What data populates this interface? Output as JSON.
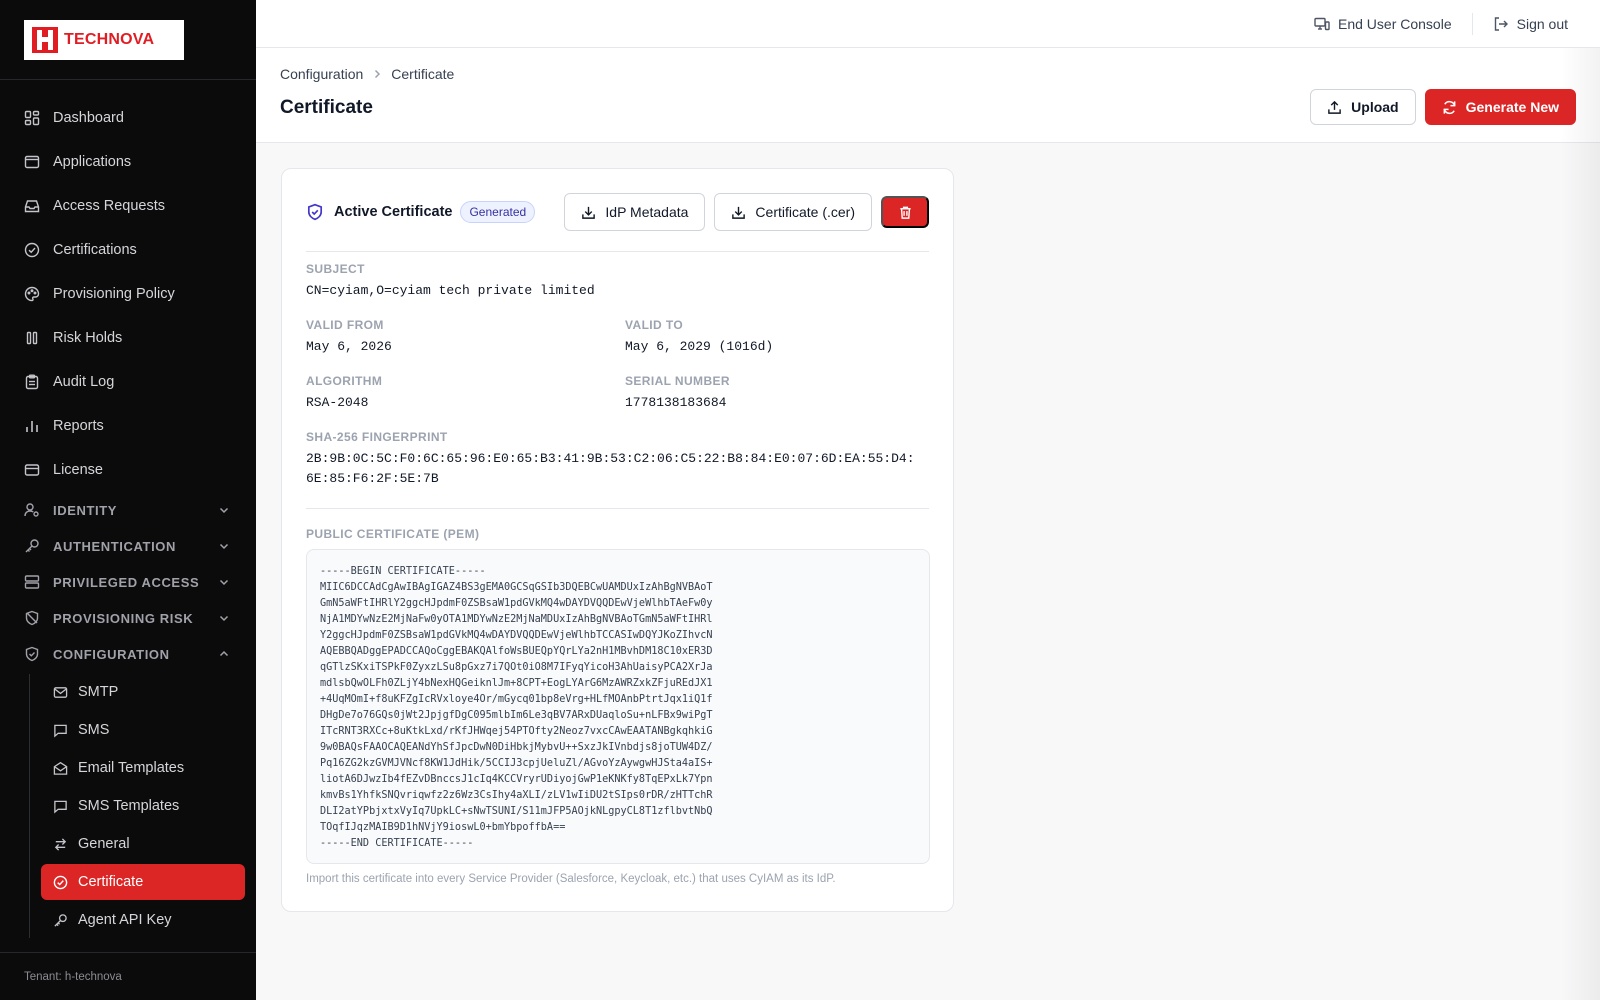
{
  "brand": {
    "name": "TECHNOVA",
    "accent": "#e11d24"
  },
  "sidebar": {
    "items": [
      {
        "label": "Dashboard",
        "icon": "dashboard-icon"
      },
      {
        "label": "Applications",
        "icon": "window-icon"
      },
      {
        "label": "Access Requests",
        "icon": "inbox-icon"
      },
      {
        "label": "Certifications",
        "icon": "check-circle-icon"
      },
      {
        "label": "Provisioning Policy",
        "icon": "palette-icon"
      },
      {
        "label": "Risk Holds",
        "icon": "pause-icon"
      },
      {
        "label": "Audit Log",
        "icon": "clipboard-icon"
      },
      {
        "label": "Reports",
        "icon": "bar-chart-icon"
      },
      {
        "label": "License",
        "icon": "card-icon"
      }
    ],
    "groups": [
      {
        "label": "IDENTITY",
        "expanded": false
      },
      {
        "label": "AUTHENTICATION",
        "expanded": false
      },
      {
        "label": "PRIVILEGED ACCESS",
        "expanded": false
      },
      {
        "label": "PROVISIONING RISK",
        "expanded": false
      },
      {
        "label": "CONFIGURATION",
        "expanded": true
      }
    ],
    "config_items": [
      {
        "label": "SMTP",
        "icon": "mail-icon"
      },
      {
        "label": "SMS",
        "icon": "message-icon"
      },
      {
        "label": "Email Templates",
        "icon": "mail-open-icon"
      },
      {
        "label": "SMS Templates",
        "icon": "message-icon"
      },
      {
        "label": "General",
        "icon": "swap-icon"
      },
      {
        "label": "Certificate",
        "icon": "certificate-icon",
        "active": true
      },
      {
        "label": "Agent API Key",
        "icon": "key-icon"
      }
    ],
    "tenant": "Tenant: h-technova"
  },
  "topbar": {
    "end_user_console": "End User Console",
    "sign_out": "Sign out"
  },
  "header": {
    "breadcrumb": [
      "Configuration",
      "Certificate"
    ],
    "title": "Certificate",
    "upload_label": "Upload",
    "generate_label": "Generate New"
  },
  "certificate": {
    "title": "Active Certificate",
    "badge": "Generated",
    "idp_metadata_label": "IdP Metadata",
    "cert_download_label": "Certificate (.cer)",
    "subject_label": "SUBJECT",
    "subject": "CN=cyiam,O=cyiam tech private limited",
    "valid_from_label": "VALID FROM",
    "valid_from": "May 6, 2026",
    "valid_to_label": "VALID TO",
    "valid_to": "May 6, 2029 (1016d)",
    "algorithm_label": "ALGORITHM",
    "algorithm": "RSA-2048",
    "serial_label": "SERIAL NUMBER",
    "serial": "1778138183684",
    "fingerprint_label": "SHA-256 FINGERPRINT",
    "fingerprint": "2B:9B:0C:5C:F0:6C:65:96:E0:65:B3:41:9B:53:C2:06:C5:22:B8:84:E0:07:6D:EA:55:D4:6E:85:F6:2F:5E:7B",
    "pem_label": "PUBLIC CERTIFICATE (PEM)",
    "pem": "-----BEGIN CERTIFICATE-----\nMIIC6DCCAdCgAwIBAgIGAZ4BS3gEMA0GCSqGSIb3DQEBCwUAMDUxIzAhBgNVBAoT\nGmN5aWFtIHRlY2ggcHJpdmF0ZSBsaW1pdGVkMQ4wDAYDVQQDEwVjeWlhbTAeFw0y\nNjA1MDYwNzE2MjNaFw0yOTA1MDYwNzE2MjNaMDUxIzAhBgNVBAoTGmN5aWFtIHRl\nY2ggcHJpdmF0ZSBsaW1pdGVkMQ4wDAYDVQQDEwVjeWlhbTCCASIwDQYJKoZIhvcN\nAQEBBQADggEPADCCAQoCggEBAKQAlfoWsBUEQpYQrLYa2nH1MBvhDM18C10xER3D\nqGTlzSKxiTSPkF0ZyxzLSu8pGxz7i7QOt0iO8M7IFyqYicoH3AhUaisyPCA2XrJa\nmdlsbQwOLFh0ZLjY4bNexHQGeiknlJm+8CPT+EogLYArG6MzAWRZxkZFjuREdJX1\n+4UqMOmI+f8uKFZgIcRVxloye4Or/mGycq01bp8eVrg+HLfMOAnbPtrtJqx1iQ1f\nDHgDe7o76GQs0jWt2JpjgfDgC095mlbIm6Le3qBV7ARxDUaqloSu+nLFBx9wiPgT\nITcRNT3RXCc+8uKtkLxd/rKfJHWqej54PTOfty2Neoz7vxcCAwEAATANBgkqhkiG\n9w0BAQsFAAOCAQEANdYhSfJpcDwN0DiHbkjMybvU++SxzJkIVnbdjs8joTUW4DZ/\nPq16ZG2kzGVMJVNcf8KW1JdHik/5CCIJ3cpjUeluZl/AGvoYzAywgwHJSta4aIS+\nliotA6DJwzIb4fEZvDBnccsJ1cIq4KCCVryrUDiyojGwP1eKNKfy8TqEPxLk7Ypn\nkmvBs1YhfkSNQvriqwfz2z6Wz3CsIhy4aXLI/zLV1wIiDU2tSIps0rDR/zHTTchR\nDLI2atYPbjxtxVyIq7UpkLC+sNwTSUNI/S11mJFP5AOjkNLgpyCL8T1zflbvtNbQ\nTOqfIJqzMAIB9D1hNVjY9ioswL0+bmYbpoffbA==\n-----END CERTIFICATE-----",
    "hint": "Import this certificate into every Service Provider (Salesforce, Keycloak, etc.) that uses CyIAM as its IdP."
  }
}
